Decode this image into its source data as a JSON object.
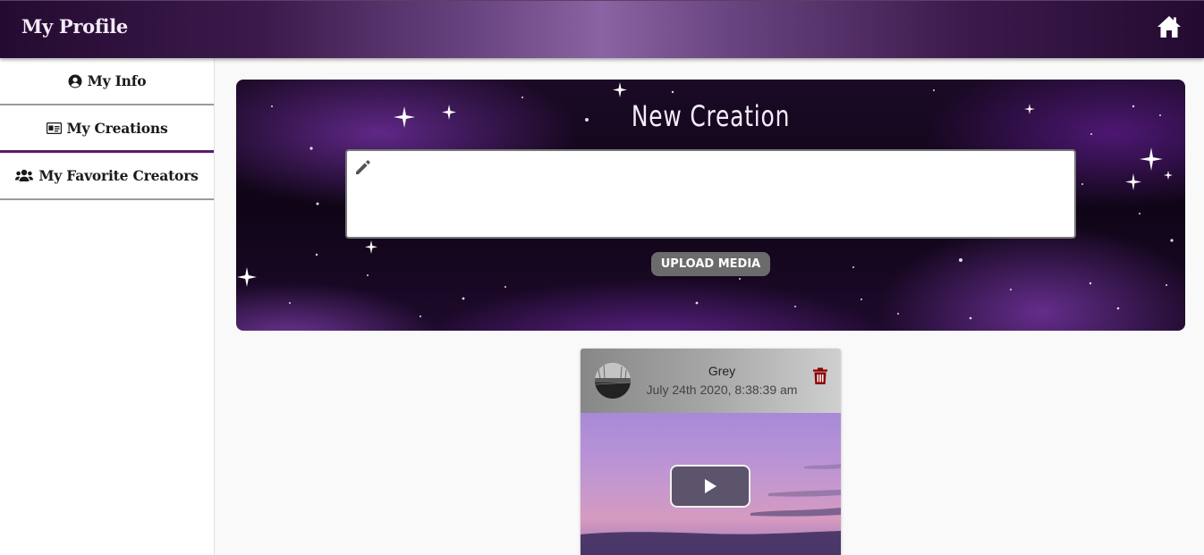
{
  "appbar": {
    "title": "My Profile",
    "home_icon": "home-icon"
  },
  "sidebar": {
    "items": [
      {
        "label": "My Info",
        "icon": "user-circle-icon",
        "active": false
      },
      {
        "label": "My Creations",
        "icon": "id-card-icon",
        "active": true
      },
      {
        "label": "My Favorite Creators",
        "icon": "users-icon",
        "active": false
      }
    ]
  },
  "new_creation": {
    "title": "New Creation",
    "input_value": "",
    "pencil_icon": "pencil-icon",
    "upload_label": "UPLOAD MEDIA"
  },
  "post": {
    "author": "Grey",
    "timestamp": "July 24th 2020, 8:38:39 am",
    "delete_icon": "trash-icon",
    "media_type": "video",
    "play_icon": "play-icon"
  },
  "colors": {
    "accent": "#5a1a6e",
    "trash": "#8b0000",
    "upload_button": "#6b6b6b"
  }
}
